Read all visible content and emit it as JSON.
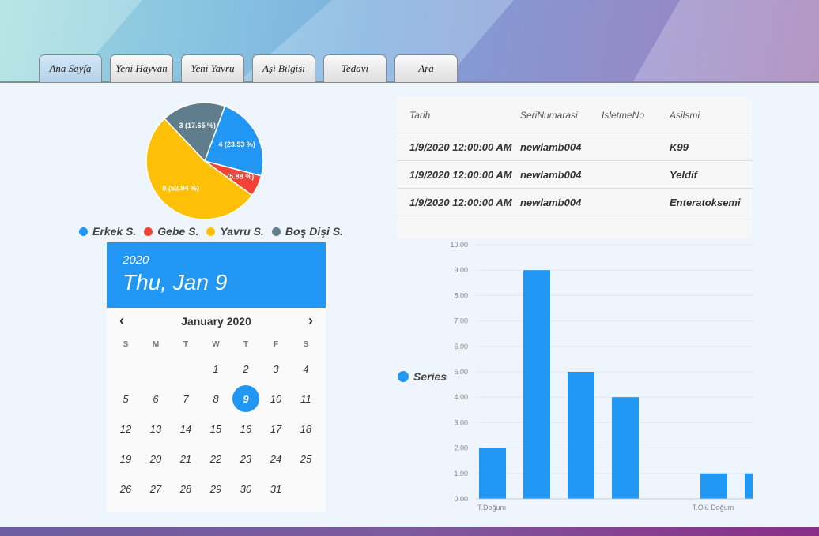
{
  "tabs": [
    {
      "label": "Ana Sayfa",
      "active": true
    },
    {
      "label": "Yeni Hayvan",
      "active": false
    },
    {
      "label": "Yeni Yavru",
      "active": false
    },
    {
      "label": "Aşi Bilgisi",
      "active": false
    },
    {
      "label": "Tedavi",
      "active": false
    },
    {
      "label": "Ara",
      "active": false
    }
  ],
  "pie": {
    "slices": [
      {
        "name": "Erkek S.",
        "value": 4,
        "label": "4 (23.53 %)",
        "color": "#2196f3"
      },
      {
        "name": "Gebe S.",
        "value": 1,
        "label": "1 (5.88 %)",
        "color": "#f44336"
      },
      {
        "name": "Yavru S.",
        "value": 9,
        "label": "9 (52.94 %)",
        "color": "#ffc107"
      },
      {
        "name": "Boş Dişi S.",
        "value": 3,
        "label": "3 (17.65 %)",
        "color": "#607d8b"
      }
    ]
  },
  "calendar": {
    "year": "2020",
    "selected_date_text": "Thu, Jan 9",
    "month_label": "January 2020",
    "weekdays": [
      "S",
      "M",
      "T",
      "W",
      "T",
      "F",
      "S"
    ],
    "first_weekday_offset": 3,
    "days_in_month": 31,
    "selected_day": 9
  },
  "table": {
    "headers": [
      "Tarih",
      "SeriNumarasi",
      "IsletmeNo",
      "Asilsmi"
    ],
    "rows": [
      [
        "1/9/2020 12:00:00 AM",
        "newlamb004",
        "",
        "K99"
      ],
      [
        "1/9/2020 12:00:00 AM",
        "newlamb004",
        "",
        "Yeldif"
      ],
      [
        "1/9/2020 12:00:00 AM",
        "newlamb004",
        "",
        "Enteratoksemi"
      ]
    ]
  },
  "chart_data": {
    "type": "bar",
    "series": [
      {
        "name": "Series",
        "values": [
          2,
          9,
          5,
          4,
          0,
          1,
          1
        ]
      }
    ],
    "categories": [
      "T.Doğum",
      "",
      "",
      "",
      "",
      "T.Ölü Doğum",
      ""
    ],
    "x_tick_labels": [
      "T.Doğum",
      "T.Ölü Doğum"
    ],
    "y_tick_labels": [
      "0.00",
      "1.00",
      "2.00",
      "3.00",
      "4.00",
      "5.00",
      "6.00",
      "7.00",
      "8.00",
      "9.00",
      "10.00"
    ],
    "ylim": [
      0,
      10
    ],
    "color": "#2196f3",
    "grid": true,
    "legend": "left"
  }
}
